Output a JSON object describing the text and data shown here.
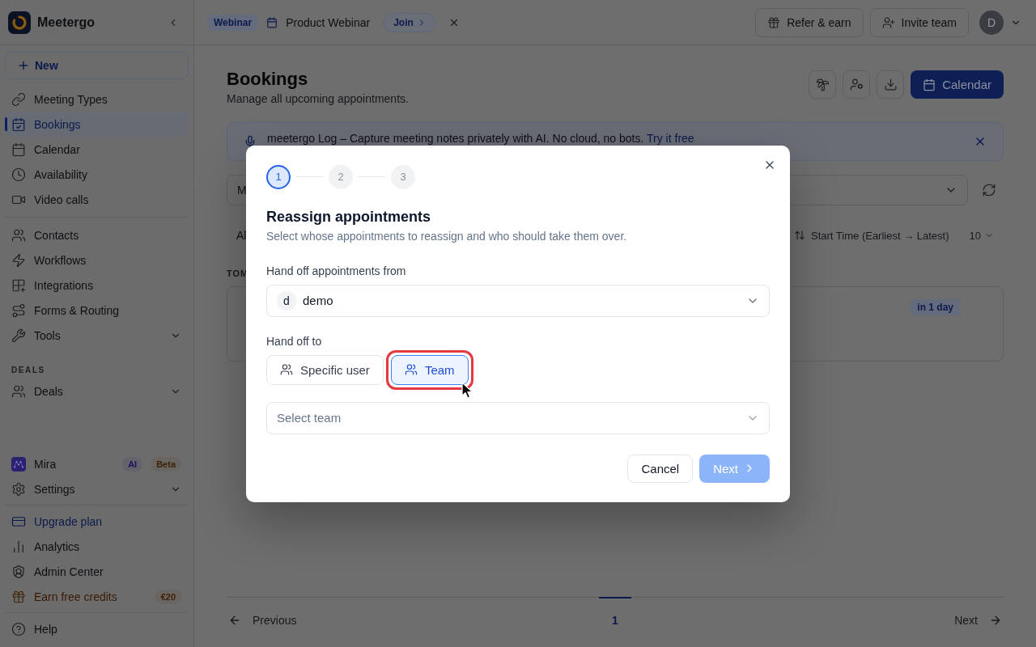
{
  "sidebar": {
    "brand": "Meetergo",
    "new_button": "New",
    "sections": [
      {
        "items": [
          {
            "label": "Meeting Types",
            "kind": "link",
            "selected": false
          },
          {
            "label": "Bookings",
            "kind": "link",
            "selected": true
          },
          {
            "label": "Calendar",
            "kind": "link",
            "selected": false
          },
          {
            "label": "Availability",
            "kind": "link",
            "selected": false
          },
          {
            "label": "Video calls",
            "kind": "link",
            "selected": false
          }
        ]
      },
      {
        "items": [
          {
            "label": "Contacts",
            "kind": "link",
            "selected": false
          },
          {
            "label": "Workflows",
            "kind": "link",
            "selected": false
          },
          {
            "label": "Integrations",
            "kind": "link",
            "selected": false
          },
          {
            "label": "Forms & Routing",
            "kind": "link",
            "selected": false
          },
          {
            "label": "Tools",
            "kind": "menu",
            "selected": false,
            "expanded": false
          }
        ]
      },
      {
        "heading": "DEALS",
        "items": [
          {
            "label": "Deals",
            "kind": "menu",
            "selected": false,
            "expanded": false
          }
        ]
      }
    ],
    "footer_sections": [
      {
        "items": [
          {
            "label": "Mira",
            "kind": "link",
            "selected": false,
            "badges": [
              {
                "label": "AI",
                "color": "#21125e"
              },
              {
                "label": "Beta",
                "color": "#3f2206"
              }
            ]
          },
          {
            "label": "Settings",
            "kind": "menu",
            "selected": false,
            "expanded": false
          }
        ]
      },
      {
        "items": [
          {
            "label": "Upgrade plan",
            "kind": "upgrade",
            "selected": false
          },
          {
            "label": "Analytics",
            "kind": "link",
            "selected": false
          },
          {
            "label": "Admin Center",
            "kind": "link",
            "selected": false
          },
          {
            "label": "Earn free credits",
            "kind": "reward",
            "selected": false,
            "badges": [
              {
                "label": "€20",
                "color": "#3f2206"
              }
            ]
          }
        ]
      },
      {
        "items": [
          {
            "label": "Help",
            "kind": "link",
            "selected": false
          }
        ]
      }
    ]
  },
  "top_bar": {
    "event": {
      "type": "Webinar",
      "title": "Product Webinar",
      "action": "Join"
    },
    "actions": [
      "Refer & earn",
      "Invite team"
    ],
    "avatar": "D"
  },
  "page": {
    "title": "Bookings",
    "subtitle": "Manage all upcoming appointments.",
    "primary_button": "Calendar",
    "banner": {
      "text": "meetergo Log – Capture meeting notes privately with AI. No cloud, no bots.",
      "link": "Try it free"
    },
    "filter_select": {
      "value": "M"
    },
    "view_filter": "Al",
    "sort": "Start Time (Earliest → Latest)",
    "page_size": "10",
    "group_heading": "TOM",
    "booking_card": {
      "badge": "in 1 day"
    },
    "pagination": {
      "previous": "Previous",
      "pages": [
        {
          "label": "1",
          "selected": true
        }
      ],
      "next": "Next"
    }
  },
  "dialog": {
    "steps": [
      {
        "label": "1",
        "current": true
      },
      {
        "label": "2",
        "current": false
      },
      {
        "label": "3",
        "current": false
      }
    ],
    "title": "Reassign appointments",
    "subtitle": "Select whose appointments to reassign and who should take them over.",
    "from": {
      "label": "Hand off appointments from",
      "avatar": "d",
      "value": "demo"
    },
    "handoff": {
      "label": "Hand off to",
      "options": [
        {
          "label": "Specific user",
          "selected": false,
          "highlighted": false
        },
        {
          "label": "Team",
          "selected": true,
          "highlighted": true
        }
      ]
    },
    "team_select": {
      "placeholder": "Select team"
    },
    "buttons": [
      {
        "label": "Cancel",
        "kind": "secondary",
        "disabled": false
      },
      {
        "label": "Next",
        "kind": "primary",
        "disabled": true
      }
    ]
  }
}
